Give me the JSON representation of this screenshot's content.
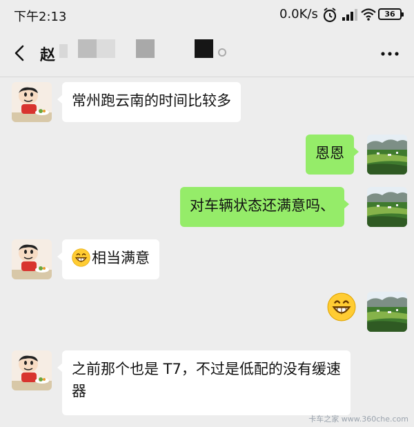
{
  "status_bar": {
    "time": "下午2:13",
    "net_speed": "0.0K/s",
    "battery": "36",
    "icons": [
      "alarm-icon",
      "signal-icon",
      "wifi-icon",
      "battery-icon"
    ]
  },
  "header": {
    "contact_name": "赵",
    "back_icon": "chevron-left-icon",
    "more_icon": "more-dots-icon"
  },
  "messages": [
    {
      "side": "left",
      "text": "常州跑云南的时间比较多"
    },
    {
      "side": "right",
      "text": "恩恩"
    },
    {
      "side": "right",
      "text": "对车辆状态还满意吗、"
    },
    {
      "side": "left",
      "emoji": "grinning-face-icon",
      "text": "相当满意"
    },
    {
      "side": "right",
      "emoji_only": "grinning-face-icon"
    },
    {
      "side": "left",
      "text": "之前那个也是 T7，不过是低配的没有缓速器"
    }
  ],
  "watermark": "卡车之家 www.360che.com",
  "colors": {
    "background": "#ededed",
    "sent_bubble": "#95ec69",
    "received_bubble": "#ffffff"
  }
}
